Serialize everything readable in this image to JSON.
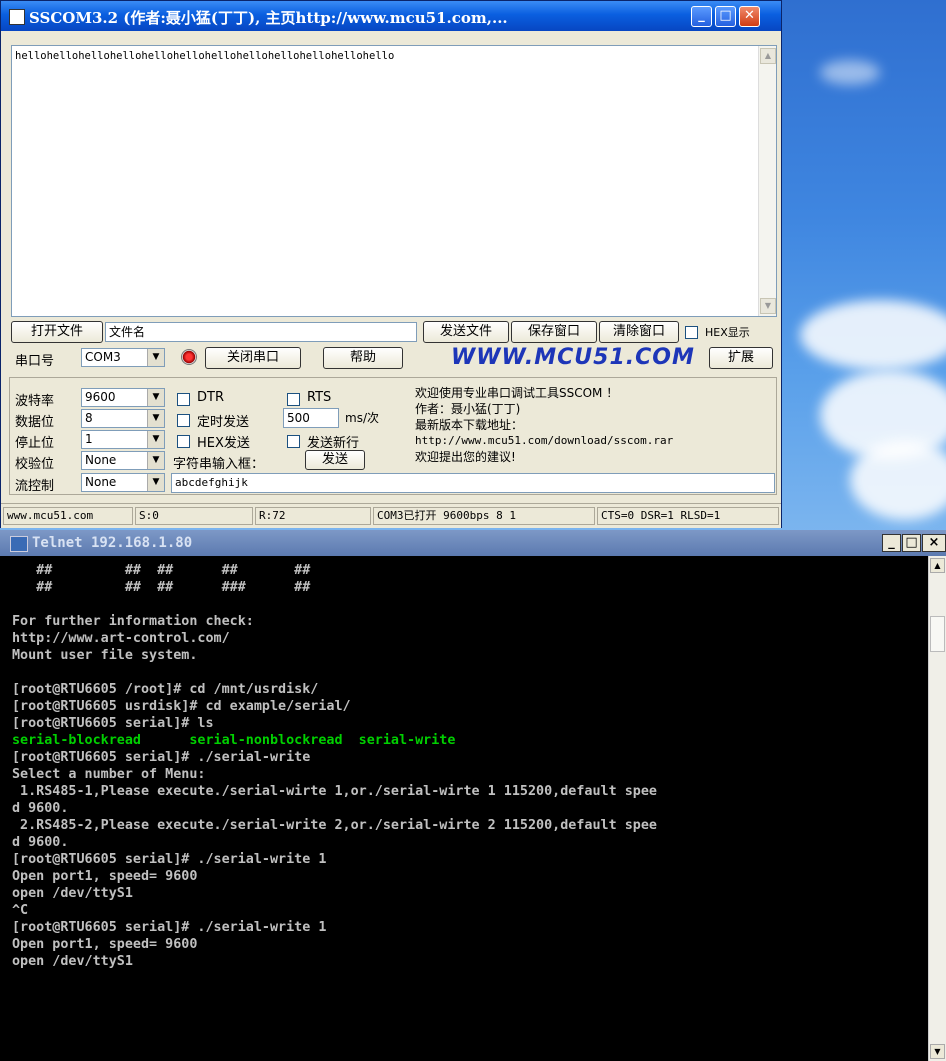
{
  "sscom": {
    "title": "SSCOM3.2 (作者:聂小猛(丁丁), 主页http://www.mcu51.com,...",
    "receive_text": "hellohellohellohellohellohellohellohellohellohellohellohello",
    "buttons": {
      "open_file": "打开文件",
      "send_file": "发送文件",
      "save_window": "保存窗口",
      "clear_window": "清除窗口",
      "close_port": "关闭串口",
      "help": "帮助",
      "expand": "扩展",
      "send": "发送"
    },
    "filename_value": "文件名",
    "hex_display_label": "HEX显示",
    "port_label": "串口号",
    "port_value": "COM3",
    "logo": "WWW.MCU51.COM",
    "baud_label": "波特率",
    "baud_value": "9600",
    "databits_label": "数据位",
    "databits_value": "8",
    "stopbits_label": "停止位",
    "stopbits_value": "1",
    "parity_label": "校验位",
    "parity_value": "None",
    "flow_label": "流控制",
    "flow_value": "None",
    "dtr_label": "DTR",
    "rts_label": "RTS",
    "timed_send_label": "定时发送",
    "interval_value": "500",
    "interval_unit": "ms/次",
    "hex_send_label": "HEX发送",
    "send_newline_label": "发送新行",
    "input_box_label": "字符串输入框：",
    "input_value": "abcdefghijk",
    "info_lines": [
      "欢迎使用专业串口调试工具SSCOM ！",
      "作者：聂小猛(丁丁)",
      "最新版本下载地址：",
      "http://www.mcu51.com/download/sscom.rar",
      "欢迎提出您的建议!"
    ],
    "status": {
      "site": "www.mcu51.com",
      "sent": "S:0",
      "received": "R:72",
      "port_state": "COM3已打开  9600bps  8 1",
      "signals": "CTS=0 DSR=1 RLSD=1"
    }
  },
  "telnet": {
    "title": "Telnet 192.168.1.80",
    "lines": [
      {
        "text": "   ##         ##  ##      ##       ##",
        "color": "#c0c0c0"
      },
      {
        "text": "   ##         ##  ##      ###      ##",
        "color": "#c0c0c0"
      },
      {
        "text": "",
        "color": "#c0c0c0"
      },
      {
        "text": "For further information check:",
        "color": "#c0c0c0"
      },
      {
        "text": "http://www.art-control.com/",
        "color": "#c0c0c0"
      },
      {
        "text": "Mount user file system.",
        "color": "#c0c0c0"
      },
      {
        "text": "",
        "color": "#c0c0c0"
      },
      {
        "text": "[root@RTU6605 /root]# cd /mnt/usrdisk/",
        "color": "#c0c0c0"
      },
      {
        "text": "[root@RTU6605 usrdisk]# cd example/serial/",
        "color": "#c0c0c0"
      },
      {
        "text": "[root@RTU6605 serial]# ls",
        "color": "#c0c0c0"
      },
      {
        "text": "serial-blockread      serial-nonblockread  serial-write",
        "color": "#00d000"
      },
      {
        "text": "[root@RTU6605 serial]# ./serial-write",
        "color": "#c0c0c0"
      },
      {
        "text": "Select a number of Menu:",
        "color": "#c0c0c0"
      },
      {
        "text": " 1.RS485-1,Please execute./serial-wirte 1,or./serial-wirte 1 115200,default spee",
        "color": "#c0c0c0"
      },
      {
        "text": "d 9600.",
        "color": "#c0c0c0"
      },
      {
        "text": " 2.RS485-2,Please execute./serial-write 2,or./serial-wirte 2 115200,default spee",
        "color": "#c0c0c0"
      },
      {
        "text": "d 9600.",
        "color": "#c0c0c0"
      },
      {
        "text": "[root@RTU6605 serial]# ./serial-write 1",
        "color": "#c0c0c0"
      },
      {
        "text": "Open port1, speed= 9600",
        "color": "#c0c0c0"
      },
      {
        "text": "open /dev/ttyS1",
        "color": "#c0c0c0"
      },
      {
        "text": "^C",
        "color": "#c0c0c0"
      },
      {
        "text": "[root@RTU6605 serial]# ./serial-write 1",
        "color": "#c0c0c0"
      },
      {
        "text": "Open port1, speed= 9600",
        "color": "#c0c0c0"
      },
      {
        "text": "open /dev/ttyS1",
        "color": "#c0c0c0"
      }
    ]
  }
}
